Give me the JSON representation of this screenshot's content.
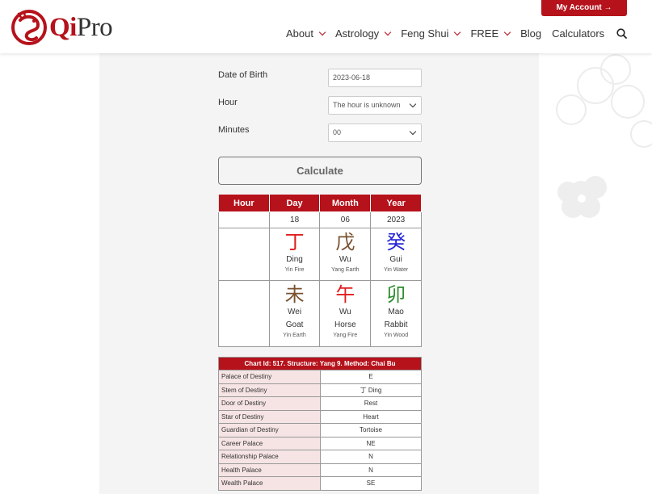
{
  "header": {
    "logo_qi": "Qi",
    "logo_pro": "Pro",
    "account_label": "My Account →",
    "nav": [
      {
        "label": "About",
        "dropdown": true
      },
      {
        "label": "Astrology",
        "dropdown": true
      },
      {
        "label": "Feng Shui",
        "dropdown": true
      },
      {
        "label": "FREE",
        "dropdown": true
      },
      {
        "label": "Blog",
        "dropdown": false
      },
      {
        "label": "Calculators",
        "dropdown": false
      }
    ],
    "search_icon": "search-icon"
  },
  "form": {
    "dob_label": "Date of Birth",
    "dob_value": "2023-06-18",
    "hour_label": "Hour",
    "hour_value": "The hour is unknown",
    "minutes_label": "Minutes",
    "minutes_value": "00",
    "calculate_label": "Calculate"
  },
  "bazi": {
    "headers": [
      "Hour",
      "Day",
      "Month",
      "Year"
    ],
    "dates": [
      "",
      "18",
      "06",
      "2023"
    ],
    "stems": [
      {
        "char": "",
        "pinyin": "",
        "element": "",
        "color": "#333333"
      },
      {
        "char": "丁",
        "pinyin": "Ding",
        "element": "Yin Fire",
        "color": "#e01f1f"
      },
      {
        "char": "戊",
        "pinyin": "Wu",
        "element": "Yang Earth",
        "color": "#7a5230"
      },
      {
        "char": "癸",
        "pinyin": "Gui",
        "element": "Yin Water",
        "color": "#2424d6"
      }
    ],
    "branches": [
      {
        "char": "",
        "pinyin": "",
        "animal": "",
        "element": "",
        "color": "#333333"
      },
      {
        "char": "未",
        "pinyin": "Wei",
        "animal": "Goat",
        "element": "Yin Earth",
        "color": "#7a5230"
      },
      {
        "char": "午",
        "pinyin": "Wu",
        "animal": "Horse",
        "element": "Yang Fire",
        "color": "#e01f1f"
      },
      {
        "char": "卯",
        "pinyin": "Mao",
        "animal": "Rabbit",
        "element": "Yin Wood",
        "color": "#2e8b2e"
      }
    ]
  },
  "qimen": {
    "title": "Chart Id: 517. Structure: Yang 9. Method: Chai Bu",
    "rows": [
      {
        "key": "Palace of Destiny",
        "value": "E"
      },
      {
        "key": "Stem of Destiny",
        "value": "丁 Ding"
      },
      {
        "key": "Door of Destiny",
        "value": "Rest"
      },
      {
        "key": "Star of Destiny",
        "value": "Heart"
      },
      {
        "key": "Guardian of Destiny",
        "value": "Tortoise"
      },
      {
        "key": "Career Palace",
        "value": "NE"
      },
      {
        "key": "Relationship Palace",
        "value": "N"
      },
      {
        "key": "Health Palace",
        "value": "N"
      },
      {
        "key": "Wealth Palace",
        "value": "SE"
      }
    ]
  },
  "colors": {
    "brand": "#b5121b"
  }
}
